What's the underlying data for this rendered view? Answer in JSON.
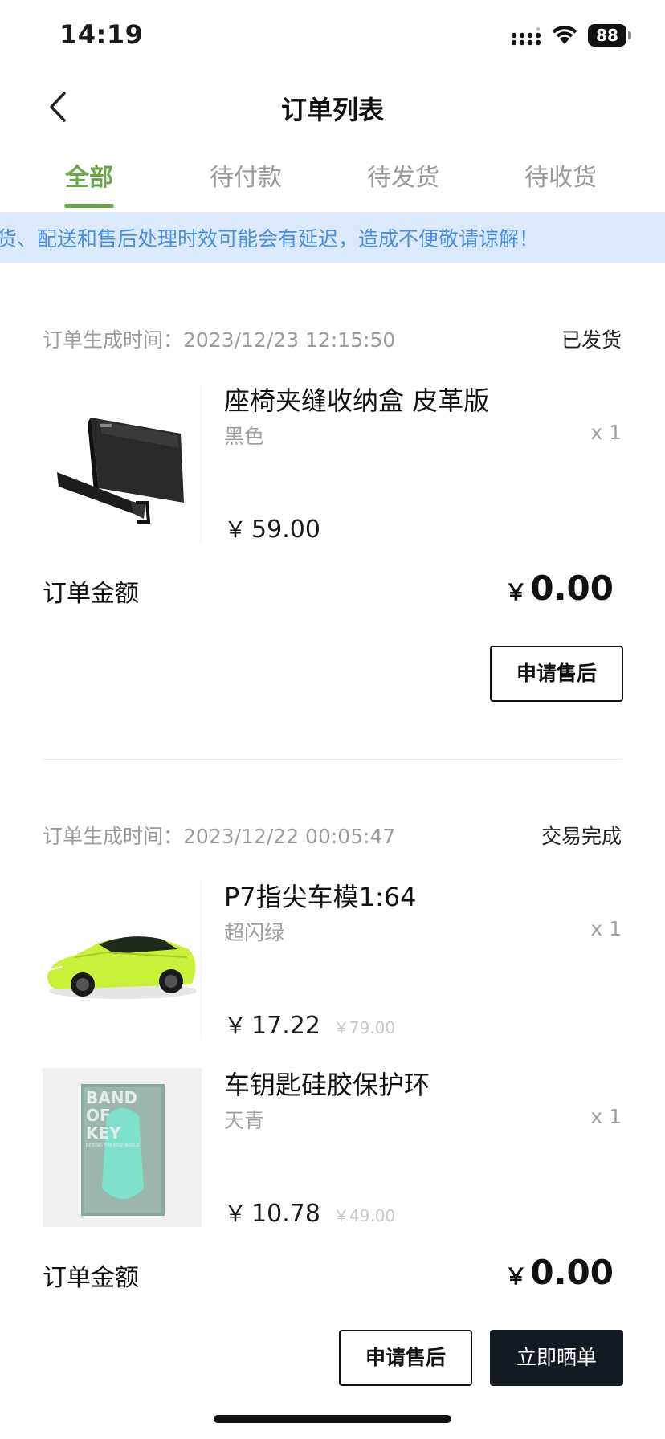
{
  "status_bar": {
    "time": "14:19",
    "battery": "88"
  },
  "nav": {
    "title": "订单列表"
  },
  "tabs": [
    {
      "label": "全部",
      "active": true
    },
    {
      "label": "待付款",
      "active": false
    },
    {
      "label": "待发货",
      "active": false
    },
    {
      "label": "待收货",
      "active": false
    }
  ],
  "notice": {
    "text": "货、配送和售后处理时效可能会有延迟，造成不便敬请谅解！"
  },
  "colors": {
    "accent": "#6aa54a",
    "notice_bg": "#dce9fb",
    "notice_text": "#4a8fdc",
    "dark_button": "#131a23"
  },
  "orders": [
    {
      "created_label": "订单生成时间：",
      "created_at": "2023/12/23 12:15:50",
      "status": "已发货",
      "items": [
        {
          "name": "座椅夹缝收纳盒 皮革版",
          "variant": "黑色",
          "qty": "x 1",
          "currency": "￥",
          "price": "59.00",
          "original_price": "",
          "image": "black-leather-organizer"
        }
      ],
      "total_label": "订单金额",
      "total_currency": "￥",
      "total": "0.00",
      "buttons": {
        "after_sales": "申请售后"
      }
    },
    {
      "created_label": "订单生成时间：",
      "created_at": "2023/12/22 00:05:47",
      "status": "交易完成",
      "items": [
        {
          "name": "P7指尖车模1:64",
          "variant": "超闪绿",
          "qty": "x 1",
          "currency": "￥",
          "price": "17.22",
          "original_price": "￥79.00",
          "image": "green-car-model"
        },
        {
          "name": "车钥匙硅胶保护环",
          "variant": "天青",
          "qty": "x 1",
          "currency": "￥",
          "price": "10.78",
          "original_price": "￥49.00",
          "image": "band-of-key-package",
          "image_text": [
            "BAND",
            "OF",
            "KEY",
            "BEYOND THE NEW WORLD"
          ]
        }
      ],
      "total_label": "订单金额",
      "total_currency": "￥",
      "total": "0.00",
      "buttons": {
        "after_sales": "申请售后",
        "show_order": "立即晒单"
      }
    }
  ]
}
